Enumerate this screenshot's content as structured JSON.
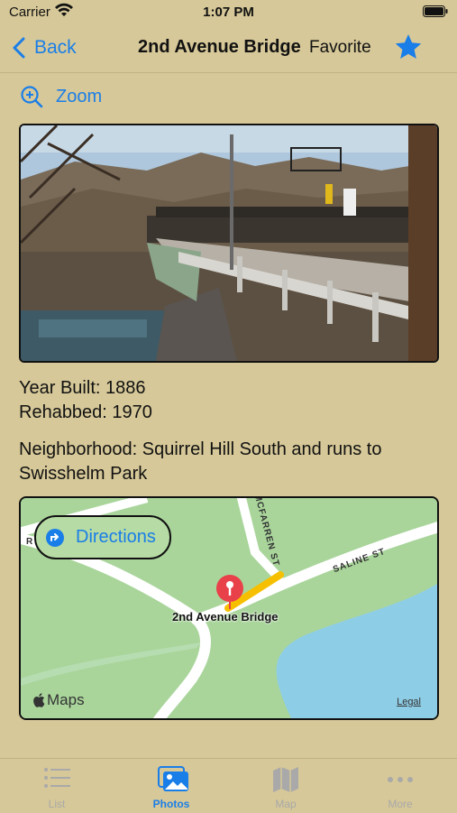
{
  "status_bar": {
    "carrier": "Carrier",
    "time": "1:07 PM"
  },
  "nav": {
    "back_label": "Back",
    "title": "2nd Avenue Bridge",
    "favorite_label": "Favorite"
  },
  "zoom": {
    "label": "Zoom"
  },
  "details": {
    "year_built": "Year Built: 1886",
    "rehabbed": "Rehabbed: 1970",
    "neighborhood_line1": "Neighborhood: Squirrel Hill South and runs to",
    "neighborhood_line2": "Swisshelm Park"
  },
  "map": {
    "directions_label": "Directions",
    "pin_label": "2nd Avenue Bridge",
    "street_1": "SALINE ST",
    "street_2": "MCFARREN ST",
    "street_3": "R",
    "attribution": "Maps",
    "legal": "Legal"
  },
  "tabs": [
    {
      "label": "List",
      "icon": "list-icon",
      "active": false
    },
    {
      "label": "Photos",
      "icon": "photos-icon",
      "active": true
    },
    {
      "label": "Map",
      "icon": "map-icon",
      "active": false
    },
    {
      "label": "More",
      "icon": "more-icon",
      "active": false
    }
  ],
  "colors": {
    "background": "#d6c898",
    "accent": "#1a7ee8",
    "inactive_tab": "#a9a9a9",
    "map_green": "#a9d59b",
    "water": "#8ecde6",
    "pin_red": "#e8414a"
  }
}
